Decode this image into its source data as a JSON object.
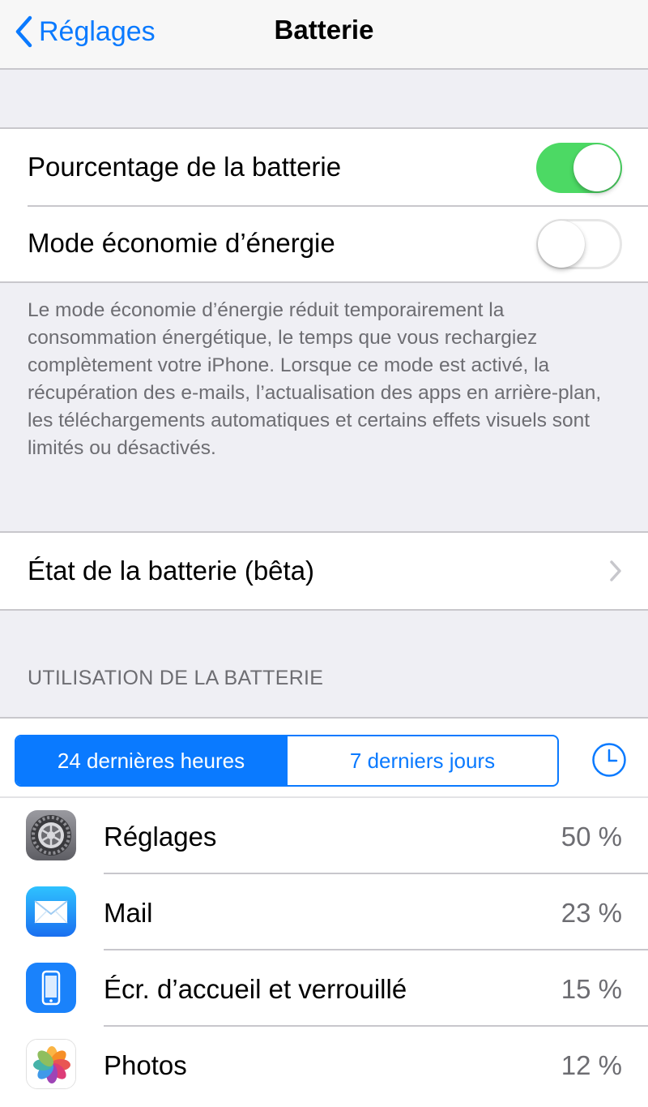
{
  "nav": {
    "back_label": "Réglages",
    "title": "Batterie"
  },
  "settings": {
    "battery_percentage": {
      "label": "Pourcentage de la batterie",
      "enabled": true
    },
    "low_power_mode": {
      "label": "Mode économie d’énergie",
      "enabled": false
    },
    "low_power_footer": "Le mode économie d’énergie réduit temporairement la consommation énergétique, le temps que vous rechargiez complètement votre iPhone. Lorsque ce mode est activé, la récupération des e-mails, l’actualisation des apps en arrière-plan, les téléchargements automatiques et certains effets visuels sont limités ou désactivés.",
    "battery_health": {
      "label": "État de la batterie (bêta)"
    }
  },
  "usage": {
    "section_title": "UTILISATION DE LA BATTERIE",
    "segments": [
      "24 dernières heures",
      "7 derniers jours"
    ],
    "selected_segment": "24 dernières heures",
    "apps": [
      {
        "name": "Réglages",
        "percent": "50 %",
        "icon": "settings-app-icon"
      },
      {
        "name": "Mail",
        "percent": "23 %",
        "icon": "mail-app-icon"
      },
      {
        "name": "Écr. d’accueil et verrouillé",
        "percent": "15 %",
        "icon": "home-lock-screen-icon"
      },
      {
        "name": "Photos",
        "percent": "12 %",
        "icon": "photos-app-icon"
      }
    ]
  },
  "colors": {
    "accent": "#0a7aff",
    "toggle_on": "#4cd964",
    "secondary_text": "#6d6d72"
  }
}
